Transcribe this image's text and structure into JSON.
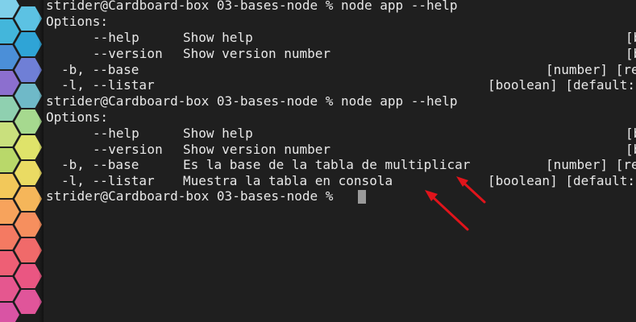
{
  "terminal": {
    "lines": [
      {
        "prompt": "strider@Cardboard-box 03-bases-node % node app --help"
      },
      {
        "text": "Options:"
      },
      {
        "flag": "--help",
        "desc": "Show help",
        "type": "[b"
      },
      {
        "flag": "--version",
        "desc": "Show version number",
        "type": "[b"
      },
      {
        "flag": "-b, --base",
        "desc": "",
        "type": "[number] [re"
      },
      {
        "flag": "-l, --listar",
        "desc": "",
        "type": "[boolean] [default:"
      },
      {
        "prompt": "strider@Cardboard-box 03-bases-node % node app --help"
      },
      {
        "text": "Options:"
      },
      {
        "flag": "--help",
        "desc": "Show help",
        "type": "[b"
      },
      {
        "flag": "--version",
        "desc": "Show version number",
        "type": "[b"
      },
      {
        "flag": "-b, --base",
        "desc": "Es la base de la tabla de multiplicar",
        "type": "[number] [re"
      },
      {
        "flag": "-l, --listar",
        "desc": "Muestra la tabla en consola",
        "type": "[boolean] [default:"
      },
      {
        "prompt": "strider@Cardboard-box 03-bases-node % "
      }
    ]
  },
  "colors": {
    "terminal_bg": "#1f1f1f",
    "text": "#e8e8e8",
    "cursor": "#9a9a9a",
    "annotation_arrow": "#e0141b"
  }
}
